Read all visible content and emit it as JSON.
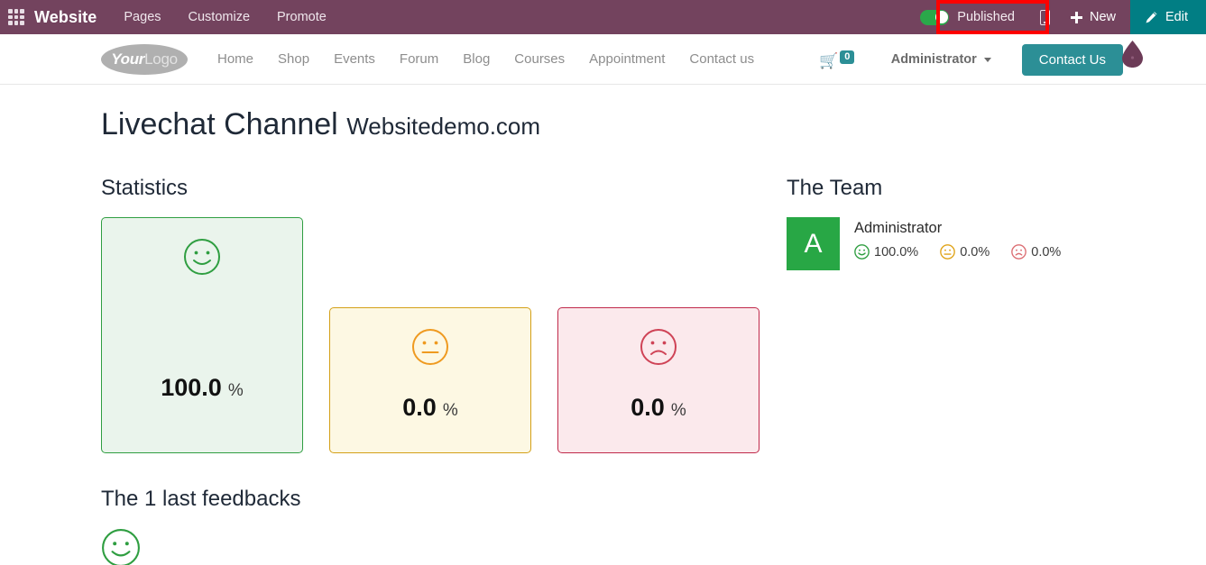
{
  "editor_bar": {
    "apps_icon": "apps-grid-icon",
    "app_name": "Website",
    "menus": [
      "Pages",
      "Customize",
      "Promote"
    ],
    "publish": {
      "label": "Published",
      "state": "on",
      "toggle_color": "#2aa84a"
    },
    "mobile_preview_icon": "mobile-phone-icon",
    "new_label": "New",
    "new_icon": "plus-icon",
    "edit_label": "Edit",
    "edit_icon": "pencil-icon",
    "bar_color": "#73435e",
    "edit_button_color": "#017e84",
    "highlight_color": "#fe0000"
  },
  "site_nav": {
    "logo": {
      "bold_part": "Your",
      "light_part": "Logo"
    },
    "links": [
      "Home",
      "Shop",
      "Events",
      "Forum",
      "Blog",
      "Courses",
      "Appointment",
      "Contact us"
    ],
    "cart": {
      "icon": "shopping-cart-icon",
      "count": "0",
      "badge_color": "#2c8f96"
    },
    "user": "Administrator",
    "contact_button": "Contact Us",
    "accent_color": "#2c8f96",
    "color_picker_icon": "droplet-icon"
  },
  "page": {
    "title_main": "Livechat Channel",
    "title_sub": "Websitedemo.com",
    "statistics_heading": "Statistics",
    "feedbacks_heading": "The 1 last feedbacks",
    "team_heading": "The Team"
  },
  "statistics": {
    "cards": [
      {
        "mood": "happy",
        "icon": "smiley-happy-icon",
        "value": "100.0",
        "unit": "%",
        "color": "#2f9e41",
        "background": "#eaf4ec"
      },
      {
        "mood": "neutral",
        "icon": "smiley-neutral-icon",
        "value": "0.0",
        "unit": "%",
        "color": "#d4a017",
        "background": "#fdf8e3"
      },
      {
        "mood": "sad",
        "icon": "smiley-sad-icon",
        "value": "0.0",
        "unit": "%",
        "color": "#c0294a",
        "background": "#fbe9ec"
      }
    ]
  },
  "feedbacks": {
    "items": [
      {
        "icon": "smiley-happy-icon",
        "color": "#2f9e41"
      }
    ]
  },
  "team": {
    "members": [
      {
        "initial": "A",
        "name": "Administrator",
        "avatar_color": "#28a745",
        "stats": [
          {
            "icon": "smiley-happy-icon",
            "value": "100.0%",
            "color": "#2f9e41"
          },
          {
            "icon": "smiley-neutral-icon",
            "value": "0.0%",
            "color": "#e0a318"
          },
          {
            "icon": "smiley-sad-icon",
            "value": "0.0%",
            "color": "#dc6d72"
          }
        ]
      }
    ]
  },
  "chart_data": {
    "type": "bar",
    "title": "Statistics",
    "categories": [
      "Happy",
      "Neutral",
      "Unhappy"
    ],
    "values": [
      100.0,
      0.0,
      0.0
    ],
    "ylabel": "%",
    "ylim": [
      0,
      100
    ]
  }
}
